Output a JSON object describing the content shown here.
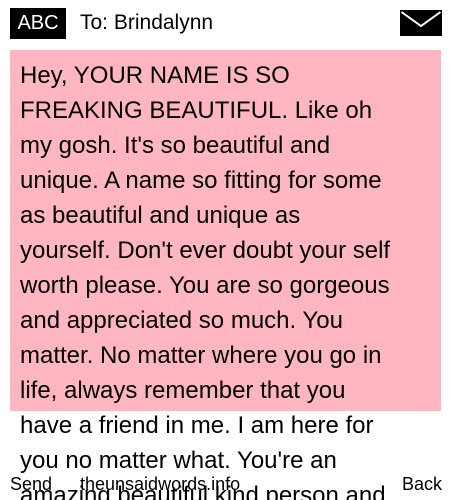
{
  "header": {
    "mode": "ABC",
    "recipient": "To: Brindalynn"
  },
  "icons": {
    "envelope": "envelope-icon"
  },
  "colors": {
    "message_background": "#ffb6c1",
    "badge_background": "#000000"
  },
  "message": {
    "text": "Hey, YOUR NAME IS SO\nFREAKING BEAUTIFUL. Like oh\nmy gosh. It's so beautiful and\nunique. A name so fitting for some\nas beautiful and unique as\nyourself. Don't ever doubt your self\nworth please. You are so gorgeous\nand appreciated so much. You\nmatter. No matter where you go in\nlife, always remember that you\nhave a friend in me. I am here for\nyou no matter what. You're an\namazing beautiful kind person and"
  },
  "footer": {
    "send": "Send",
    "site": "theunsaidwords.info",
    "back": "Back"
  }
}
